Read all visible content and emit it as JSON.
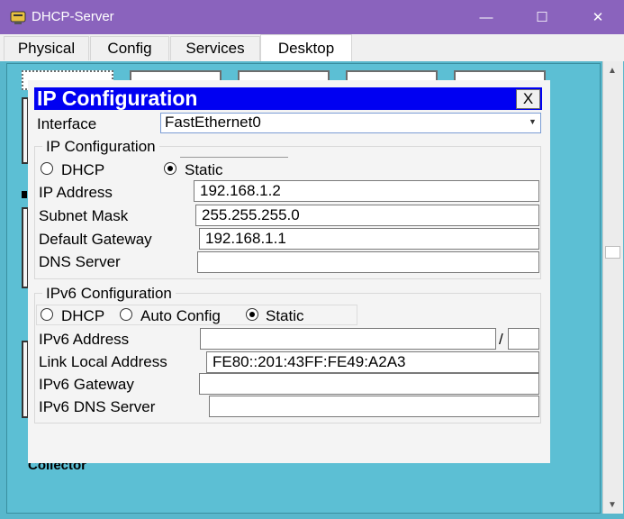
{
  "window": {
    "title": "DHCP-Server",
    "controls": {
      "minimize": "—",
      "maximize": "☐",
      "close": "✕"
    }
  },
  "tabs": [
    {
      "label": "Physical"
    },
    {
      "label": "Config"
    },
    {
      "label": "Services"
    },
    {
      "label": "Desktop",
      "active": true
    }
  ],
  "desktop": {
    "partial_label": "Collector"
  },
  "ip_config": {
    "title": "IP Configuration",
    "close_label": "X",
    "interface_label": "Interface",
    "interface_value": "FastEthernet0",
    "ipv4": {
      "group_title": "IP Configuration",
      "dhcp_label": "DHCP",
      "static_label": "Static",
      "mode": "Static",
      "ip_address_label": "IP Address",
      "ip_address_value": "192.168.1.2",
      "subnet_mask_label": "Subnet Mask",
      "subnet_mask_value": "255.255.255.0",
      "default_gateway_label": "Default Gateway",
      "default_gateway_value": "192.168.1.1",
      "dns_server_label": "DNS Server",
      "dns_server_value": ""
    },
    "ipv6": {
      "group_title": "IPv6 Configuration",
      "dhcp_label": "DHCP",
      "auto_config_label": "Auto Config",
      "static_label": "Static",
      "mode": "Static",
      "address_label": "IPv6 Address",
      "address_value": "",
      "prefix_separator": "/",
      "prefix_value": "",
      "link_local_label": "Link Local Address",
      "link_local_value": "FE80::201:43FF:FE49:A2A3",
      "gateway_label": "IPv6 Gateway",
      "gateway_value": "",
      "dns_label": "IPv6 DNS Server",
      "dns_value": ""
    }
  },
  "colors": {
    "titlebar": "#8a63bd",
    "desktop_bg": "#58b7cc",
    "dialog_title_bg": "#0000f2"
  }
}
